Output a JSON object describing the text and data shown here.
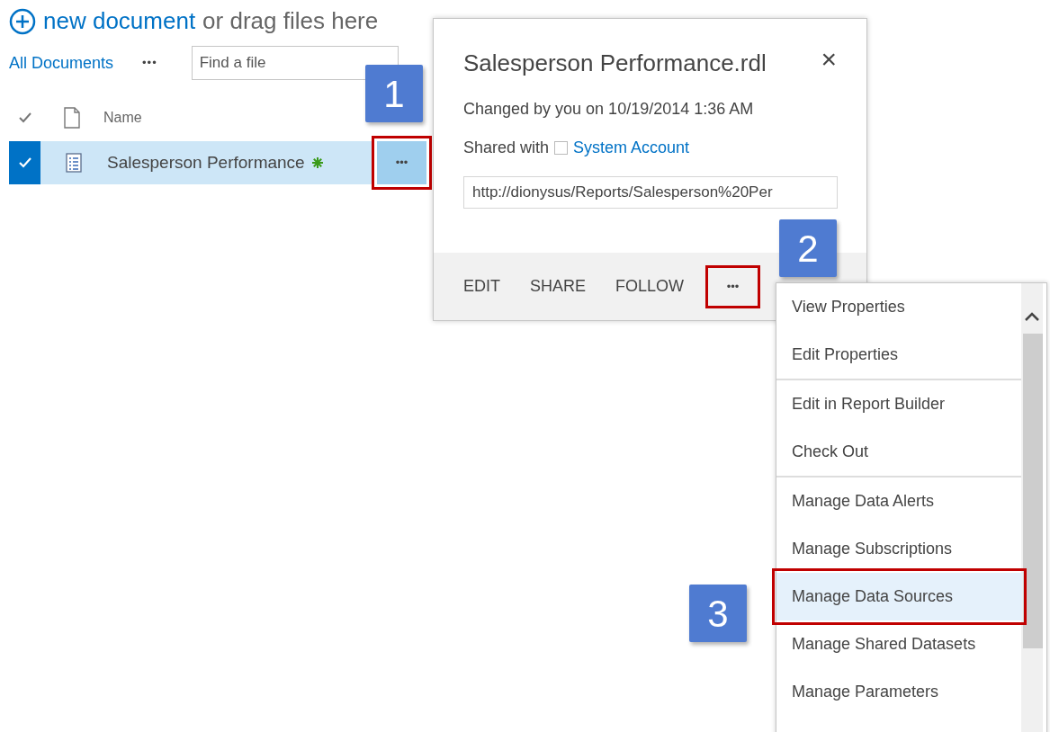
{
  "header": {
    "link": "new document",
    "text": "or drag files here"
  },
  "view": {
    "label": "All Documents",
    "more": "•••",
    "search": {
      "placeholder": "Find a file"
    }
  },
  "list": {
    "columns": [
      {
        "label": "Name"
      }
    ],
    "rows": [
      {
        "name": "Salesperson Performance",
        "selected": true,
        "is_new": true,
        "more": {
          "label": "•••",
          "highlighted": true
        }
      }
    ]
  },
  "callout": {
    "title": "Salesperson Performance.rdl",
    "close": "×",
    "changed": "Changed by you on 10/19/2014 1:36 AM",
    "shared_label": "Shared with",
    "shared_user": "System Account",
    "url": "http://dionysus/Reports/Salesperson%20Per",
    "actions": [
      "EDIT",
      "SHARE",
      "FOLLOW"
    ],
    "more": {
      "label": "•••",
      "highlighted": true
    }
  },
  "menu": {
    "groups": [
      [
        {
          "label": "View Properties",
          "selected": false,
          "highlighted": false
        },
        {
          "label": "Edit Properties",
          "selected": false,
          "highlighted": false
        }
      ],
      [
        {
          "label": "Edit in Report Builder",
          "selected": false,
          "highlighted": false
        },
        {
          "label": "Check Out",
          "selected": false,
          "highlighted": false
        }
      ],
      [
        {
          "label": "Manage Data Alerts",
          "selected": false,
          "highlighted": false
        },
        {
          "label": "Manage Subscriptions",
          "selected": false,
          "highlighted": false
        },
        {
          "label": "Manage Data Sources",
          "selected": true,
          "highlighted": true
        },
        {
          "label": "Manage Shared Datasets",
          "selected": false,
          "highlighted": false
        },
        {
          "label": "Manage Parameters",
          "selected": false,
          "highlighted": false
        }
      ]
    ]
  },
  "steps": [
    {
      "number": "1"
    },
    {
      "number": "2"
    },
    {
      "number": "3"
    }
  ]
}
